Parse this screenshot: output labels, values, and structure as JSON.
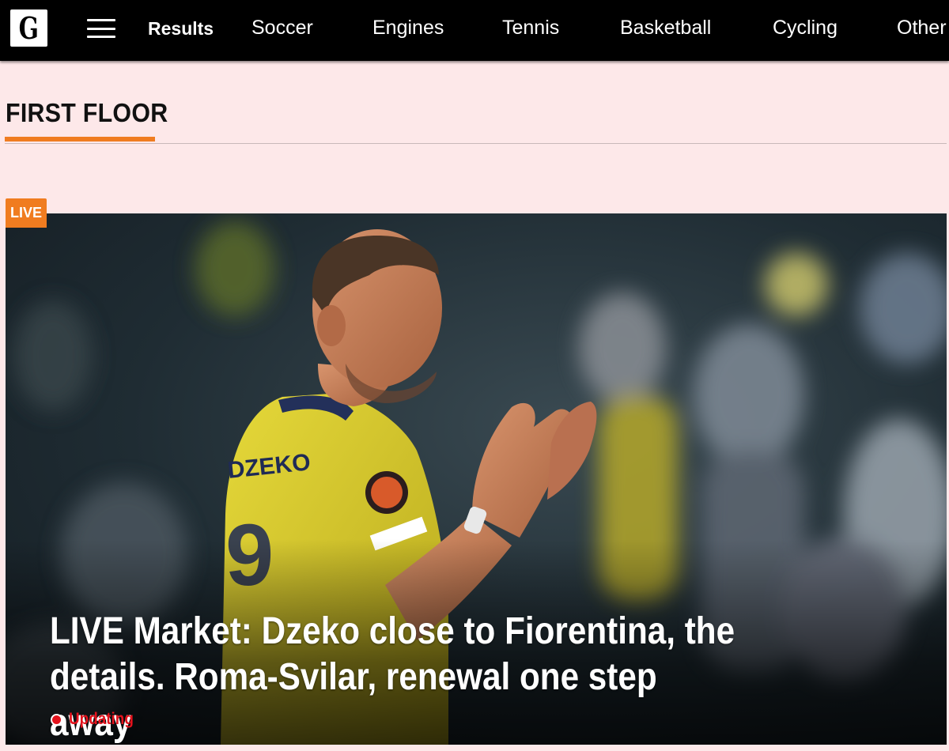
{
  "header": {
    "logo_letter": "G",
    "menu_icon": "hamburger-menu-icon",
    "nav": [
      {
        "label": "Results",
        "active": true
      },
      {
        "label": "Soccer"
      },
      {
        "label": "Engines"
      },
      {
        "label": "Tennis"
      },
      {
        "label": "Basketball"
      },
      {
        "label": "Cycling"
      },
      {
        "label": "Other"
      }
    ]
  },
  "section": {
    "title": "FIRST FLOOR",
    "accent_color": "#f07c20"
  },
  "hero": {
    "badge": "LIVE",
    "headline": "LIVE Market: Dzeko close to Fiorentina, the details. Roma-Svilar, renewal one step away",
    "status_icon": "live-dot-icon",
    "status_label": "Updating",
    "status_color": "#e3121c"
  }
}
